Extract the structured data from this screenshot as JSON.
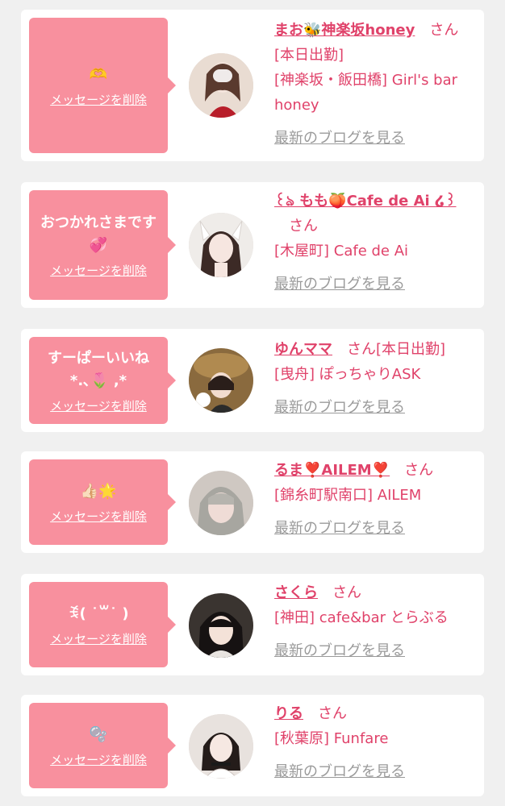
{
  "delete_label": "メッセージを削除",
  "blog_label": "最新のブログを見る",
  "colors": {
    "accent": "#e0426a",
    "bubble": "#f8909e",
    "link_gray": "#9a9a9a",
    "background": "#f0f0f0"
  },
  "messages": [
    {
      "message": "🫶",
      "name": "まお🐝神楽坂honey",
      "san": "さん",
      "status": "[本日出勤]",
      "shop": "[神楽坂・飯田橋] Girl's bar honey"
    },
    {
      "message": "おつかれさまです\n💞",
      "name": "꒰ঌ もも🍑Cafe de Ai ໒꒱",
      "san": "さん",
      "status": "",
      "shop": "[木屋町] Cafe de Ai"
    },
    {
      "message": "すーぱーいいね\n*.､🌷 ,*",
      "name": "ゆんママ",
      "san": "さん",
      "status": "[本日出勤]",
      "shop": "[曳舟] ぽっちゃりASK"
    },
    {
      "message": "👍🏻🌟",
      "name": "るま❣️AILEM❣️",
      "san": "さん",
      "status": "",
      "shop": "[錦糸町駅南口] AILEM"
    },
    {
      "message": "ꉂ( ˙꒳˙ )",
      "name": "さくら",
      "san": "さん",
      "status": "",
      "shop": "[神田] cafe&bar とらぶる"
    },
    {
      "message": "🫧",
      "name": "りる",
      "san": "さん",
      "status": "",
      "shop": "[秋葉原] Funfare"
    }
  ]
}
